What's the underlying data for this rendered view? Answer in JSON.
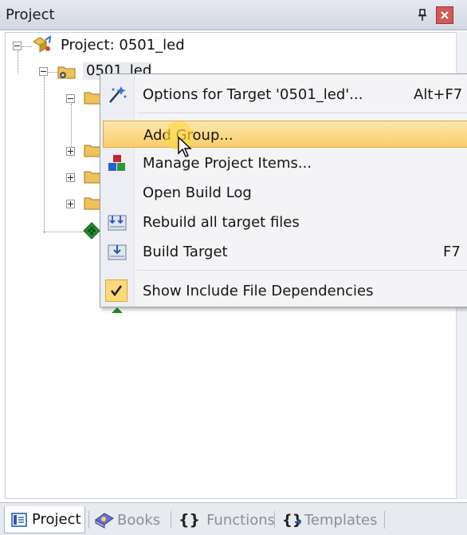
{
  "window": {
    "title": "Project"
  },
  "tree": {
    "root_label": "Project: 0501_led",
    "target_label": "0501_led"
  },
  "context_menu": {
    "items": [
      {
        "label": "Options for Target '0501_led'...",
        "shortcut": "Alt+F7",
        "icon": "magic-wand-icon"
      },
      {
        "label": "Add Group...",
        "shortcut": "",
        "icon": "",
        "highlighted": true
      },
      {
        "label": "Manage Project Items...",
        "shortcut": "",
        "icon": "project-items-icon"
      },
      {
        "label": "Open Build Log",
        "shortcut": "",
        "icon": ""
      },
      {
        "label": "Rebuild all target files",
        "shortcut": "",
        "icon": "rebuild-icon"
      },
      {
        "label": "Build Target",
        "shortcut": "F7",
        "icon": "build-icon"
      },
      {
        "label": "Show Include File Dependencies",
        "shortcut": "",
        "icon": "checkmark-icon",
        "checked": true
      }
    ]
  },
  "tabs": [
    {
      "label": "Project",
      "icon": "project-tab-icon",
      "active": true
    },
    {
      "label": "Books",
      "icon": "books-icon",
      "active": false
    },
    {
      "label": "Functions",
      "icon": "braces-icon",
      "active": false
    },
    {
      "label": "Templates",
      "icon": "templates-icon",
      "active": false
    }
  ],
  "colors": {
    "highlight": "#f9cd69",
    "close_button": "#cf5a58"
  }
}
